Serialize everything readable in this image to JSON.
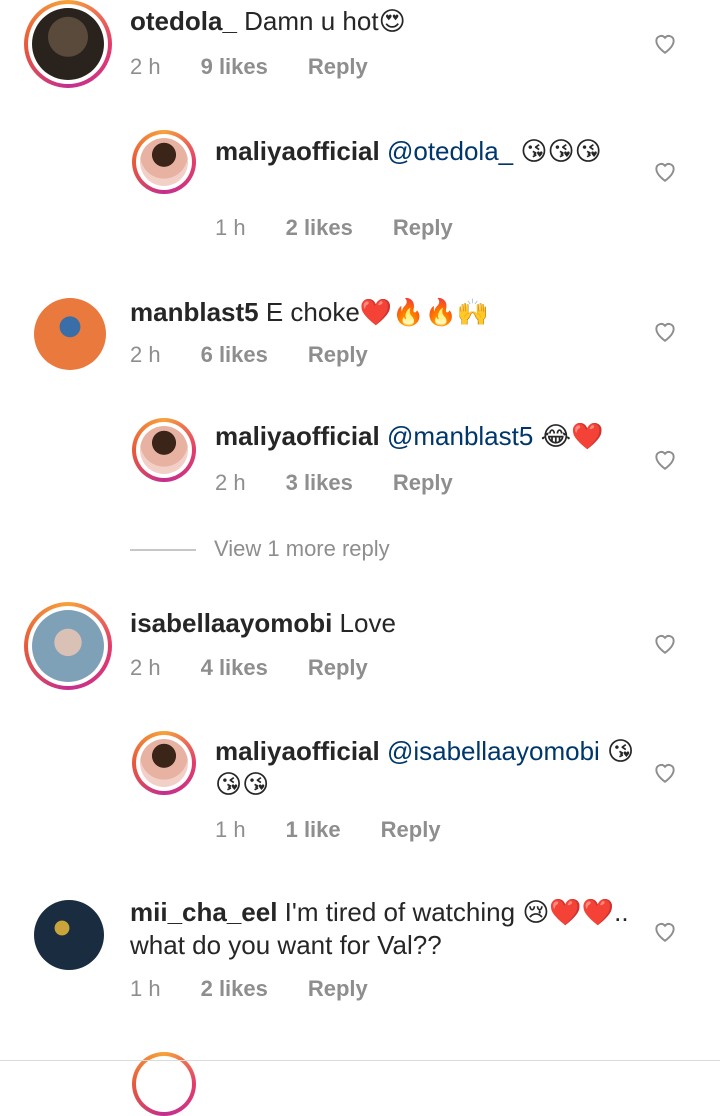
{
  "comments": [
    {
      "user": "otedola_",
      "text": "Damn u hot",
      "time": "2 h",
      "likes": "9 likes",
      "reply": "Reply",
      "emojis": "😍"
    },
    {
      "user": "maliyaofficial",
      "mention": "@otedola_",
      "text": "",
      "time": "1 h",
      "likes": "2 likes",
      "reply": "Reply",
      "emojis": "😘😘😘"
    },
    {
      "user": "manblast5",
      "text": "E choke",
      "time": "2 h",
      "likes": "6 likes",
      "reply": "Reply",
      "emojis": "❤️🔥🔥🙌"
    },
    {
      "user": "maliyaofficial",
      "mention": "@manblast5",
      "text": "",
      "time": "2 h",
      "likes": "3 likes",
      "reply": "Reply",
      "emojis": "😂❤️"
    },
    {
      "user": "isabellaayomobi",
      "text": "Love",
      "time": "2 h",
      "likes": "4 likes",
      "reply": "Reply"
    },
    {
      "user": "maliyaofficial",
      "mention": "@isabellaayomobi",
      "text": "",
      "time": "1 h",
      "likes": "1 like",
      "reply": "Reply",
      "emojis": "😘😘😘"
    },
    {
      "user": "mii_cha_eel",
      "text": "I'm tired of watching",
      "text2": "..",
      "line2": "what do you want for Val??",
      "time": "1 h",
      "likes": "2 likes",
      "reply": "Reply",
      "emojis": "😢❤️❤️"
    }
  ],
  "view_more": "View 1 more reply",
  "colors": {
    "ring_start": "#f6a23a",
    "ring_mid": "#e33b6b",
    "mention": "#00376b",
    "meta": "#8e8e8e"
  },
  "icons": {
    "like": "heart-outline-icon"
  }
}
